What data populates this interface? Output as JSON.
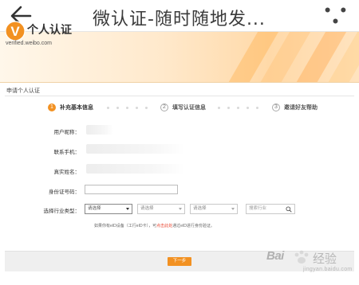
{
  "app_bar": {
    "title": "微认证-随时随地发...",
    "back_icon": "back-arrow-icon",
    "more_icon": "more-dots-icon",
    "more_label": "• • •"
  },
  "banner": {
    "logo_letter": "V",
    "logo_title": "个人认证",
    "logo_sub": "verified.weibo.com",
    "accent_color": "#f29122"
  },
  "page": {
    "section_title": "申请个人认证",
    "steps": [
      {
        "num": "1",
        "label": "补充基本信息",
        "active": true
      },
      {
        "num": "2",
        "label": "填写认证信息",
        "active": false
      },
      {
        "num": "3",
        "label": "邀请好友帮助",
        "active": false
      }
    ],
    "fields": {
      "nickname_label": "用户昵称：",
      "phone_label": "联系手机：",
      "realname_label": "真实姓名：",
      "idcard_label": "身份证号码："
    },
    "industry": {
      "label": "选择行业类型：",
      "select_1": "请选择",
      "select_2": "请选择",
      "select_3": "请选择",
      "select_4": "请选择",
      "search_placeholder": "搜索行业"
    },
    "note": {
      "before": "如果你有eID设备（工行eID卡），可",
      "link": "点击此处",
      "after": "通过eID进行身份验证。"
    },
    "next_button": "下一步"
  },
  "watermark": {
    "brand": "Bai",
    "brand_cn": "经验",
    "sub": "jingyan.baidu.com"
  }
}
